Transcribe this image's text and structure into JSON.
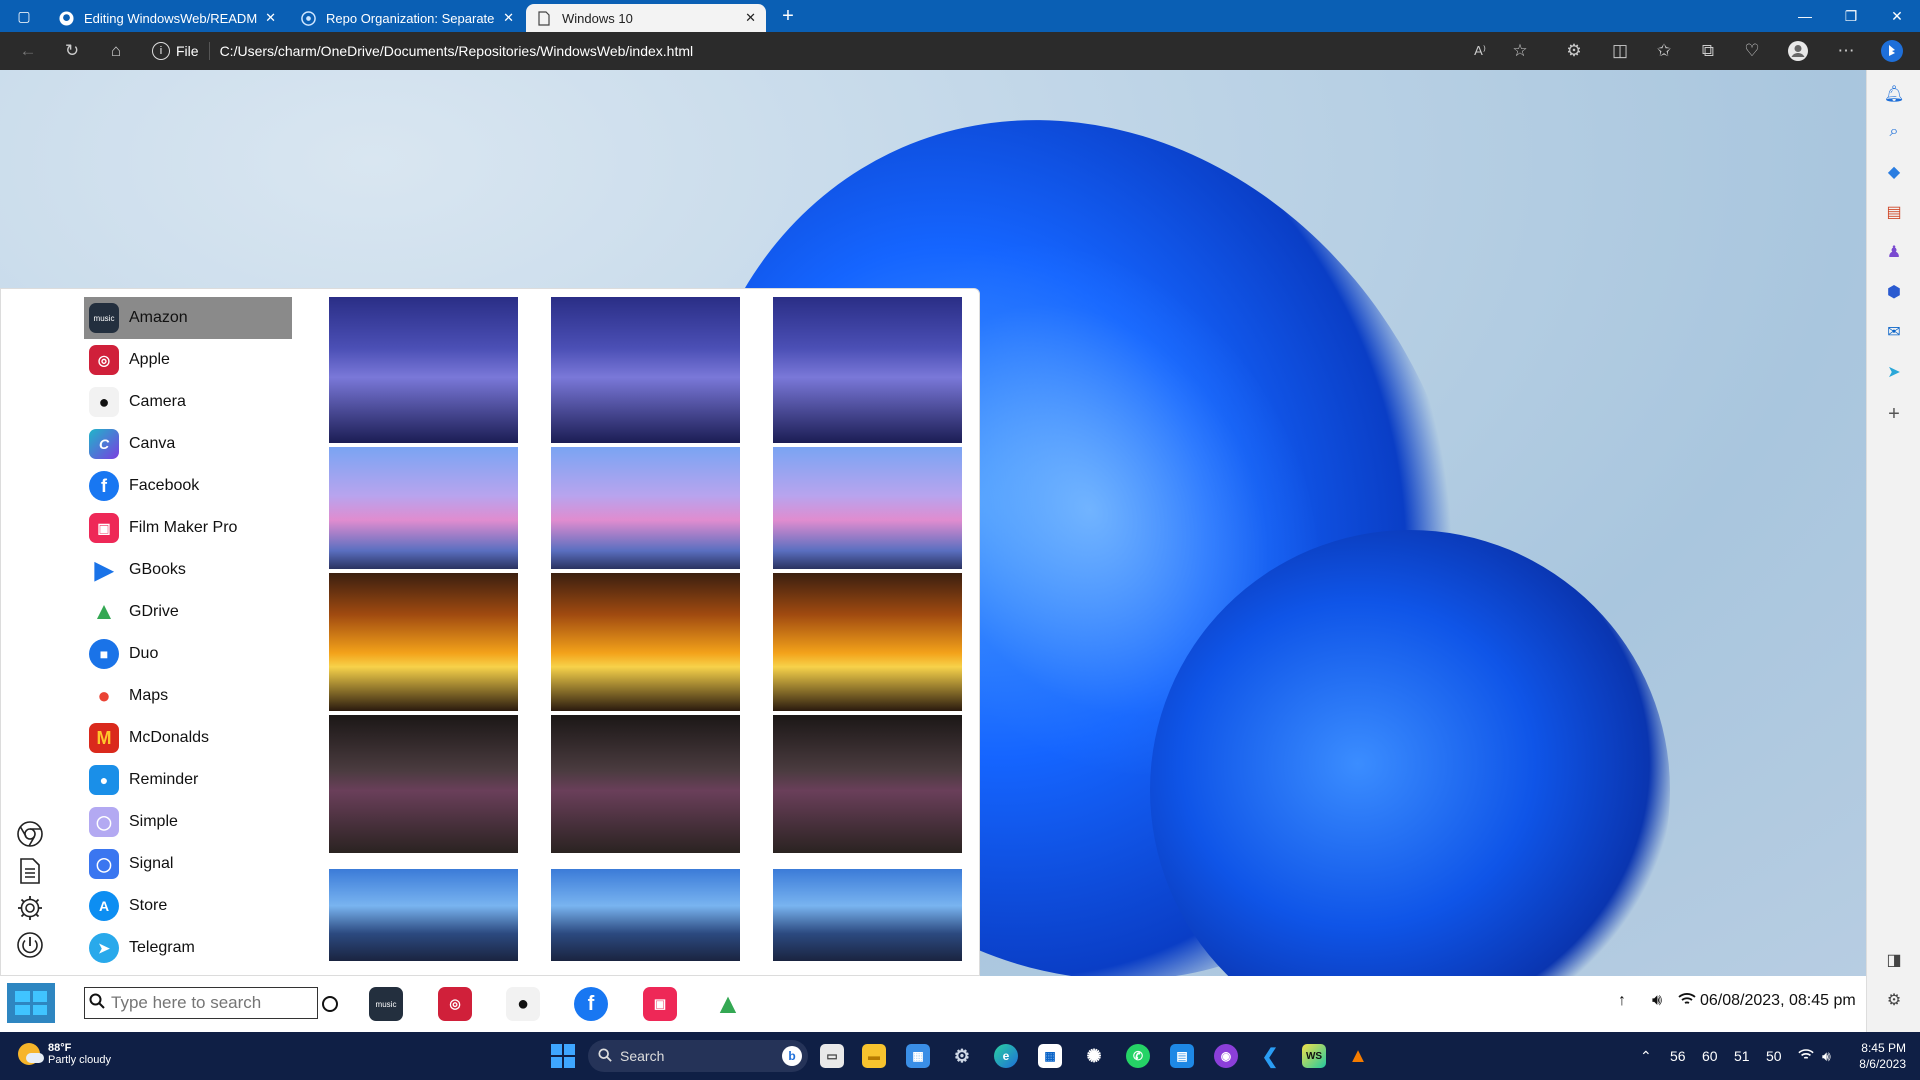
{
  "browser": {
    "tabs": [
      {
        "label": "Editing WindowsWeb/README.r",
        "icon": "github-icon"
      },
      {
        "label": "Repo Organization: Separate or",
        "icon": "chatgpt-icon"
      },
      {
        "label": "Windows 10",
        "icon": "page-icon",
        "active": true
      }
    ],
    "new_tab": "+",
    "address_chip": "File",
    "url": "C:/Users/charm/OneDrive/Documents/Repositories/WindowsWeb/index.html"
  },
  "start_menu": {
    "apps": [
      {
        "label": "Amazon",
        "icon": "amazon-music-icon",
        "color": "#232f3e",
        "glyph": "music"
      },
      {
        "label": "Apple",
        "icon": "apple-icon",
        "color": "#d0203a",
        "glyph": "◎"
      },
      {
        "label": "Camera",
        "icon": "camera-icon",
        "color": "#f2f2f2",
        "glyph": "●"
      },
      {
        "label": "Canva",
        "icon": "canva-icon",
        "color": "#1fb6c9",
        "glyph": "C"
      },
      {
        "label": "Facebook",
        "icon": "facebook-icon",
        "color": "#1877f2",
        "glyph": "f"
      },
      {
        "label": "Film Maker Pro",
        "icon": "film-maker-icon",
        "color": "#ee2857",
        "glyph": "▣"
      },
      {
        "label": "GBooks",
        "icon": "google-books-icon",
        "color": "#1a73e8",
        "glyph": "▶"
      },
      {
        "label": "GDrive",
        "icon": "google-drive-icon",
        "color": "#34a853",
        "glyph": "▲"
      },
      {
        "label": "Duo",
        "icon": "duo-icon",
        "color": "#1a73e8",
        "glyph": "■"
      },
      {
        "label": "Maps",
        "icon": "maps-icon",
        "color": "#ea4335",
        "glyph": "●"
      },
      {
        "label": "McDonalds",
        "icon": "mcdonalds-icon",
        "color": "#da291c",
        "glyph": "M"
      },
      {
        "label": "Reminder",
        "icon": "reminder-icon",
        "color": "#1a8fe8",
        "glyph": "●"
      },
      {
        "label": "Simple",
        "icon": "simple-icon",
        "color": "#8c7be6",
        "glyph": "◯"
      },
      {
        "label": "Signal",
        "icon": "signal-icon",
        "color": "#3a76f0",
        "glyph": "◯"
      },
      {
        "label": "Store",
        "icon": "app-store-icon",
        "color": "#0d8ef2",
        "glyph": "A"
      },
      {
        "label": "Telegram",
        "icon": "telegram-icon",
        "color": "#29a9eb",
        "glyph": "➤"
      }
    ],
    "rail": [
      "chrome-wheel-icon",
      "document-icon",
      "settings-gear-icon",
      "power-icon"
    ]
  },
  "web_taskbar": {
    "search_placeholder": "Type here to search",
    "pinned": [
      {
        "icon": "amazon-music-icon",
        "color": "#232f3e",
        "glyph": "music"
      },
      {
        "icon": "apple-icon",
        "color": "#d0203a",
        "glyph": "◎"
      },
      {
        "icon": "camera-icon",
        "color": "#f2f2f2",
        "glyph": "●"
      },
      {
        "icon": "facebook-icon",
        "color": "#1877f2",
        "glyph": "f"
      },
      {
        "icon": "film-maker-icon",
        "color": "#ee2857",
        "glyph": "▣"
      },
      {
        "icon": "google-drive-icon",
        "color": "#34a853",
        "glyph": "▲"
      }
    ],
    "tray_arrow": "↑",
    "datetime": "06/08/2023, 08:45 pm"
  },
  "taskbar": {
    "temperature": "88°F",
    "weather": "Partly cloudy",
    "search_label": "Search",
    "tray_numbers": [
      "56",
      "60",
      "51",
      "50"
    ],
    "time": "8:45 PM",
    "date": "8/6/2023"
  }
}
